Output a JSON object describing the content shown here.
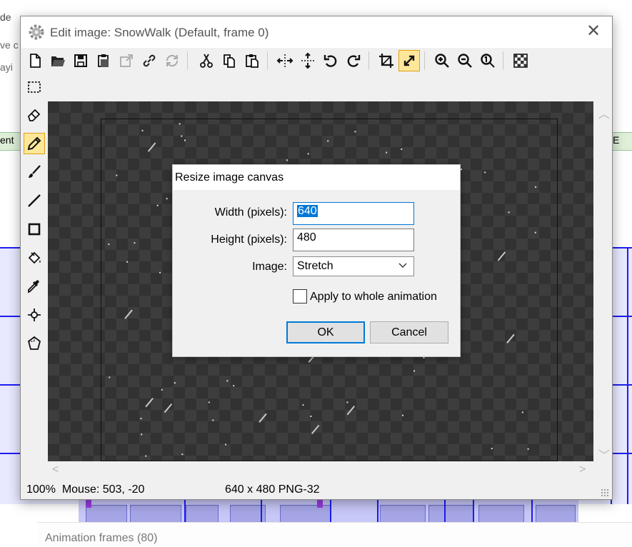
{
  "background": {
    "fragments": [
      "de",
      "ve c",
      "ayi"
    ],
    "strip_left_text": "ent",
    "strip_right_text": "E",
    "animation_panel_title": "Animation frames (80)"
  },
  "window": {
    "title": "Edit image: SnowWalk (Default, frame 0)",
    "close_label": "✕"
  },
  "toolbar": {
    "buttons": [
      "new-file",
      "open-folder",
      "save",
      "paste-new",
      "export",
      "link",
      "refresh",
      "cut",
      "copy",
      "paste",
      "flip-horizontal",
      "flip-vertical",
      "rotate-left",
      "rotate-right",
      "crop",
      "resize-canvas",
      "zoom-in",
      "zoom-out",
      "zoom-actual",
      "transparency"
    ],
    "active": "resize-canvas"
  },
  "tools": {
    "items": [
      "select-rectangle",
      "eraser",
      "pencil",
      "brush",
      "line",
      "rectangle",
      "fill-bucket",
      "eyedropper",
      "origin-crosshair",
      "polygon-select"
    ],
    "active": "pencil"
  },
  "status": {
    "zoom": "100%",
    "mouse": "Mouse: 503, -20",
    "size_format": "640 x 480  PNG-32"
  },
  "dialog": {
    "title": "Resize image canvas",
    "width_label": "Width (pixels):",
    "width_value": "640",
    "height_label": "Height (pixels):",
    "height_value": "480",
    "image_label": "Image:",
    "image_option": "Stretch",
    "checkbox_label": "Apply to whole animation",
    "checkbox_checked": false,
    "ok_label": "OK",
    "cancel_label": "Cancel"
  },
  "colors": {
    "accent": "#0078d7",
    "active_tool_bg": "#ffe79a",
    "canvas_dark": "#323232"
  }
}
